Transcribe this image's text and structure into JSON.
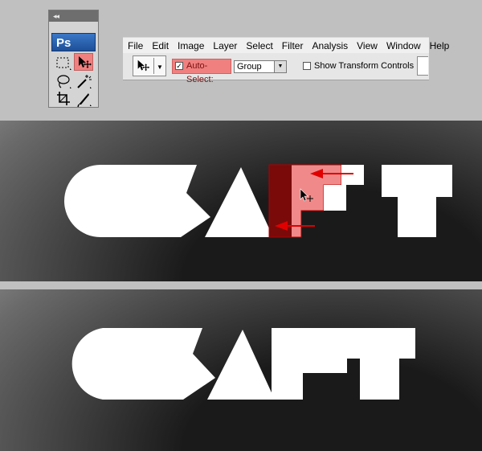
{
  "tools_panel": {
    "collapse_glyph": "◂◂",
    "logo": "Ps",
    "tools": [
      {
        "name": "rectangular-marquee-icon"
      },
      {
        "name": "move-tool-icon",
        "active": true
      },
      {
        "name": "lasso-icon"
      },
      {
        "name": "magic-wand-icon"
      },
      {
        "name": "crop-icon"
      },
      {
        "name": "slice-icon"
      }
    ]
  },
  "menubar": {
    "items": [
      "File",
      "Edit",
      "Image",
      "Layer",
      "Select",
      "Filter",
      "Analysis",
      "View",
      "Window",
      "Help"
    ]
  },
  "options_bar": {
    "auto_select_label": "Auto-Select:",
    "auto_select_checked": "✓",
    "select_value": "Group",
    "show_transform_label": "Show Transform Controls"
  },
  "colors": {
    "highlight": "#f08080",
    "highlight_dark": "#7a0a0a",
    "arrow": "#e00000",
    "logo_blue": "#2a5fb0"
  },
  "canvas_top": {
    "text_shape": "CRAFT",
    "annotations": [
      "red-arrow-upper",
      "red-arrow-lower"
    ]
  },
  "canvas_bottom": {
    "text_shape": "CRAFT"
  }
}
